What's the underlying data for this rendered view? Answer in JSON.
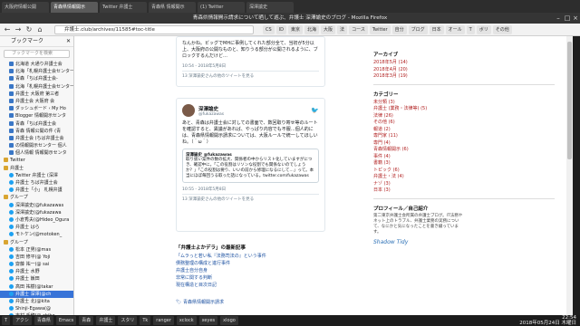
{
  "window": {
    "caption": "青森県情報開示請求について晒して遊ぶ、弁護士 深澤諭史のブログ - Mozilla Firefox",
    "tabs": [
      "大阪府情報公開",
      "青森県情報開示",
      "Twitter 弁護士",
      "青森県 情報開示",
      "(1) Twitter",
      "深澤諭史"
    ],
    "active_tab": 1
  },
  "navbar": {
    "url": "弁護士.club/archives/11585#toc-title",
    "bookmarks": [
      "CS",
      "ID",
      "東京",
      "北海",
      "大阪",
      "法",
      "コース",
      "Twitter",
      "自分",
      "ブログ",
      "日本",
      "オール",
      "T",
      "ボリ",
      "その他"
    ]
  },
  "sidebar": {
    "title": "ブックマーク",
    "search_placeholder": "ブックマークを検索",
    "items": [
      {
        "label": "北海道 大通り弁護士会",
        "type": "page"
      },
      {
        "label": "北海「札幌弁護士会センター",
        "type": "page"
      },
      {
        "label": "青森「ちば弁護士会-",
        "type": "page"
      },
      {
        "label": "北海「札幌弁護士会センター",
        "type": "page"
      },
      {
        "label": "弁護士 大阪府 第三者",
        "type": "page"
      },
      {
        "label": "弁護士会 大阪府 会",
        "type": "page"
      },
      {
        "label": "ダッシュボード ‹ My Ho",
        "type": "page"
      },
      {
        "label": "Blogger 情報開示センタ",
        "type": "page"
      },
      {
        "label": "青森「ちば弁護士会",
        "type": "page"
      },
      {
        "label": "青森 情報公開の件 (青",
        "type": "page"
      },
      {
        "label": "弁護士会 (ちば弁護士会",
        "type": "page"
      },
      {
        "label": "の情報開示センター 個人",
        "type": "page"
      },
      {
        "label": "個人情報 情報開示センタ",
        "type": "page"
      },
      {
        "label": "Twitter",
        "type": "folder"
      },
      {
        "label": "弁護士",
        "type": "folder"
      },
      {
        "label": "Twitter 弁護士 (深澤",
        "type": "tw"
      },
      {
        "label": "弁護士 ちば弁護士会",
        "type": "tw"
      },
      {
        "label": "弁護士「小」 札幌弁護",
        "type": "tw"
      },
      {
        "label": "グループ",
        "type": "folder"
      },
      {
        "label": "深澤諭史(@fukazawas",
        "type": "tw"
      },
      {
        "label": "深澤諭史(@fukazawa",
        "type": "tw"
      },
      {
        "label": "小倉秀夫(@Hideo_Ogura",
        "type": "tw"
      },
      {
        "label": "弁護士 はら",
        "type": "tw"
      },
      {
        "label": "モトケン(@motoken_",
        "type": "tw"
      },
      {
        "label": "グループ",
        "type": "folder"
      },
      {
        "label": "松本 正男(@mas",
        "type": "tw"
      },
      {
        "label": "吉田 修平(@ Yoji",
        "type": "tw"
      },
      {
        "label": "齋藤 祐一(@ sai",
        "type": "tw"
      },
      {
        "label": "弁護士 水野",
        "type": "tw"
      },
      {
        "label": "弁護士 飯田",
        "type": "tw"
      },
      {
        "label": "高田 祐樹(@takar",
        "type": "tw"
      },
      {
        "label": "弁護士 深澤(@ch",
        "type": "tw",
        "selected": true
      },
      {
        "label": "弁護士 北(@kita",
        "type": "tw"
      },
      {
        "label": "Shinji-Egawa(@",
        "type": "tw"
      },
      {
        "label": "吉村 千穂(@ chiho",
        "type": "tw"
      },
      {
        "label": "ぱぱぱ(@rshinji",
        "type": "tw"
      },
      {
        "label": "黒田 (@ kuroda",
        "type": "tw"
      }
    ]
  },
  "tweet1": {
    "text": "なんかね。ビッグでMHに事例してくれた部分全て、当初が5分以上、大阪府の公開なものと、知りうる部分が公開されるように、ブロックするんだけど…",
    "date": "10:54 - 2018年5月8日",
    "actions": "13 深澤諭史さんの他のツイートを見る"
  },
  "tweet2": {
    "name": "深澤諭史",
    "handle": "@fukazawas",
    "text": "あと、青森は弁護士会に対しての書面で、数回取り寄せ等のルートを確認すると、異議があれば、やっぱり内容でも不服…個人的には、青森県情報開示請求については、大阪ルールで統一してほしいね。（＾ω＾）",
    "quote_name": "深澤諭史 @fukazawas",
    "quote_text": "取り扱い案件の数の拡大、関係者の中からリスト化していますがにつき、確認中に。「この役割はリソンな役割でも関係ないのでしょうか？」「この役割は要り、いいの前から修理になるにして…」って。本当にほぼ毎回うる取った話になっている。twitter.com/fukazawas",
    "date": "10:55 - 2018年5月8日",
    "actions": "13 深澤諭史さんの他のツイートを見る"
  },
  "related": {
    "title": "「弁護士よかデラ」の最新記事",
    "links": [
      "「ムラっと若い私『法務司法の』という事件",
      "債務整理の構成と進行事件",
      "弁護士自分自身",
      "非常に関する判断",
      "現在構造と目次日記"
    ]
  },
  "footer_tag": "青森県情報開示請求",
  "right": {
    "archive_title": "アーカイブ",
    "archives": [
      "2018年5月 (14)",
      "2018年4月 (20)",
      "2018年3月 (19)"
    ],
    "category_title": "カテゴリー",
    "categories": [
      "未分類 (3)",
      "弁護士 (業務・法律等) (5)",
      "法律 (26)",
      "その他 (6)",
      "報道 (2)",
      "専門家 (11)",
      "専門 (4)",
      "青森情報開示 (6)",
      "事件 (4)",
      "書籍 (3)",
      "トピック (6)",
      "弁護士・法 (4)",
      "ナゾ (3)",
      "日本 (3)"
    ],
    "profile_title": "プロフィール／自己紹介",
    "profile_text": "第二東京弁護士会所属の弁護士ブログ。IT法務やネット上のトラブル、弁護士業務の実務について、なにかと気になったことを書き綴っています。",
    "brand": "Shadow Tidy"
  },
  "taskbar": {
    "items": [
      "T",
      "アクシ",
      "青森県",
      "Emacs",
      "青森",
      "弁護士",
      "スタリ",
      "Tk",
      "ranger",
      "xclock",
      "xeyes",
      "xlogo"
    ],
    "time": "22:54",
    "date": "2018年05月24日 木曜日"
  }
}
